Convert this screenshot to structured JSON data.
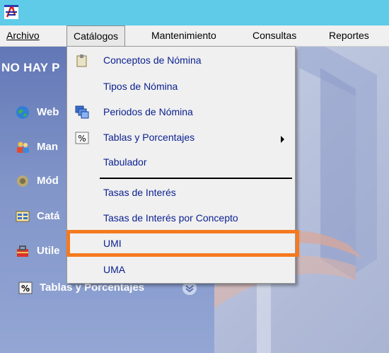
{
  "menubar": {
    "items": [
      "Archivo",
      "Catálogos",
      "Mantenimiento",
      "Consultas",
      "Reportes"
    ]
  },
  "sidebar": {
    "header": "NO HAY P",
    "items": [
      {
        "label": "Web",
        "icon": "globe-icon"
      },
      {
        "label": "Man",
        "icon": "users-icon"
      },
      {
        "label": "Mód",
        "icon": "gear-icon"
      },
      {
        "label": "Catá",
        "icon": "catalog-icon"
      },
      {
        "label": "Utile",
        "icon": "toolbox-icon"
      },
      {
        "label": "Tablas y Porcentajes",
        "icon": "percent-icon"
      }
    ]
  },
  "dropdown": {
    "items": [
      {
        "label": "Conceptos de Nómina",
        "icon": "clip-icon"
      },
      {
        "label": "Tipos de Nómina",
        "icon": ""
      },
      {
        "label": "Periodos de Nómina",
        "icon": "windows-icon"
      },
      {
        "label": "Tablas y Porcentajes",
        "icon": "percent-icon",
        "submenu": true
      },
      {
        "label": "Tabulador",
        "icon": ""
      },
      {
        "label": "Tasas de Interés",
        "icon": ""
      },
      {
        "label": "Tasas de Interés por Concepto",
        "icon": ""
      },
      {
        "label": "UMI",
        "icon": ""
      },
      {
        "label": "UMA",
        "icon": ""
      }
    ]
  },
  "colors": {
    "titlebar": "#5fcbe8",
    "menu_text": "#0a1f8f",
    "highlight": "#f47a20",
    "sidebar": "#7f92c4"
  }
}
